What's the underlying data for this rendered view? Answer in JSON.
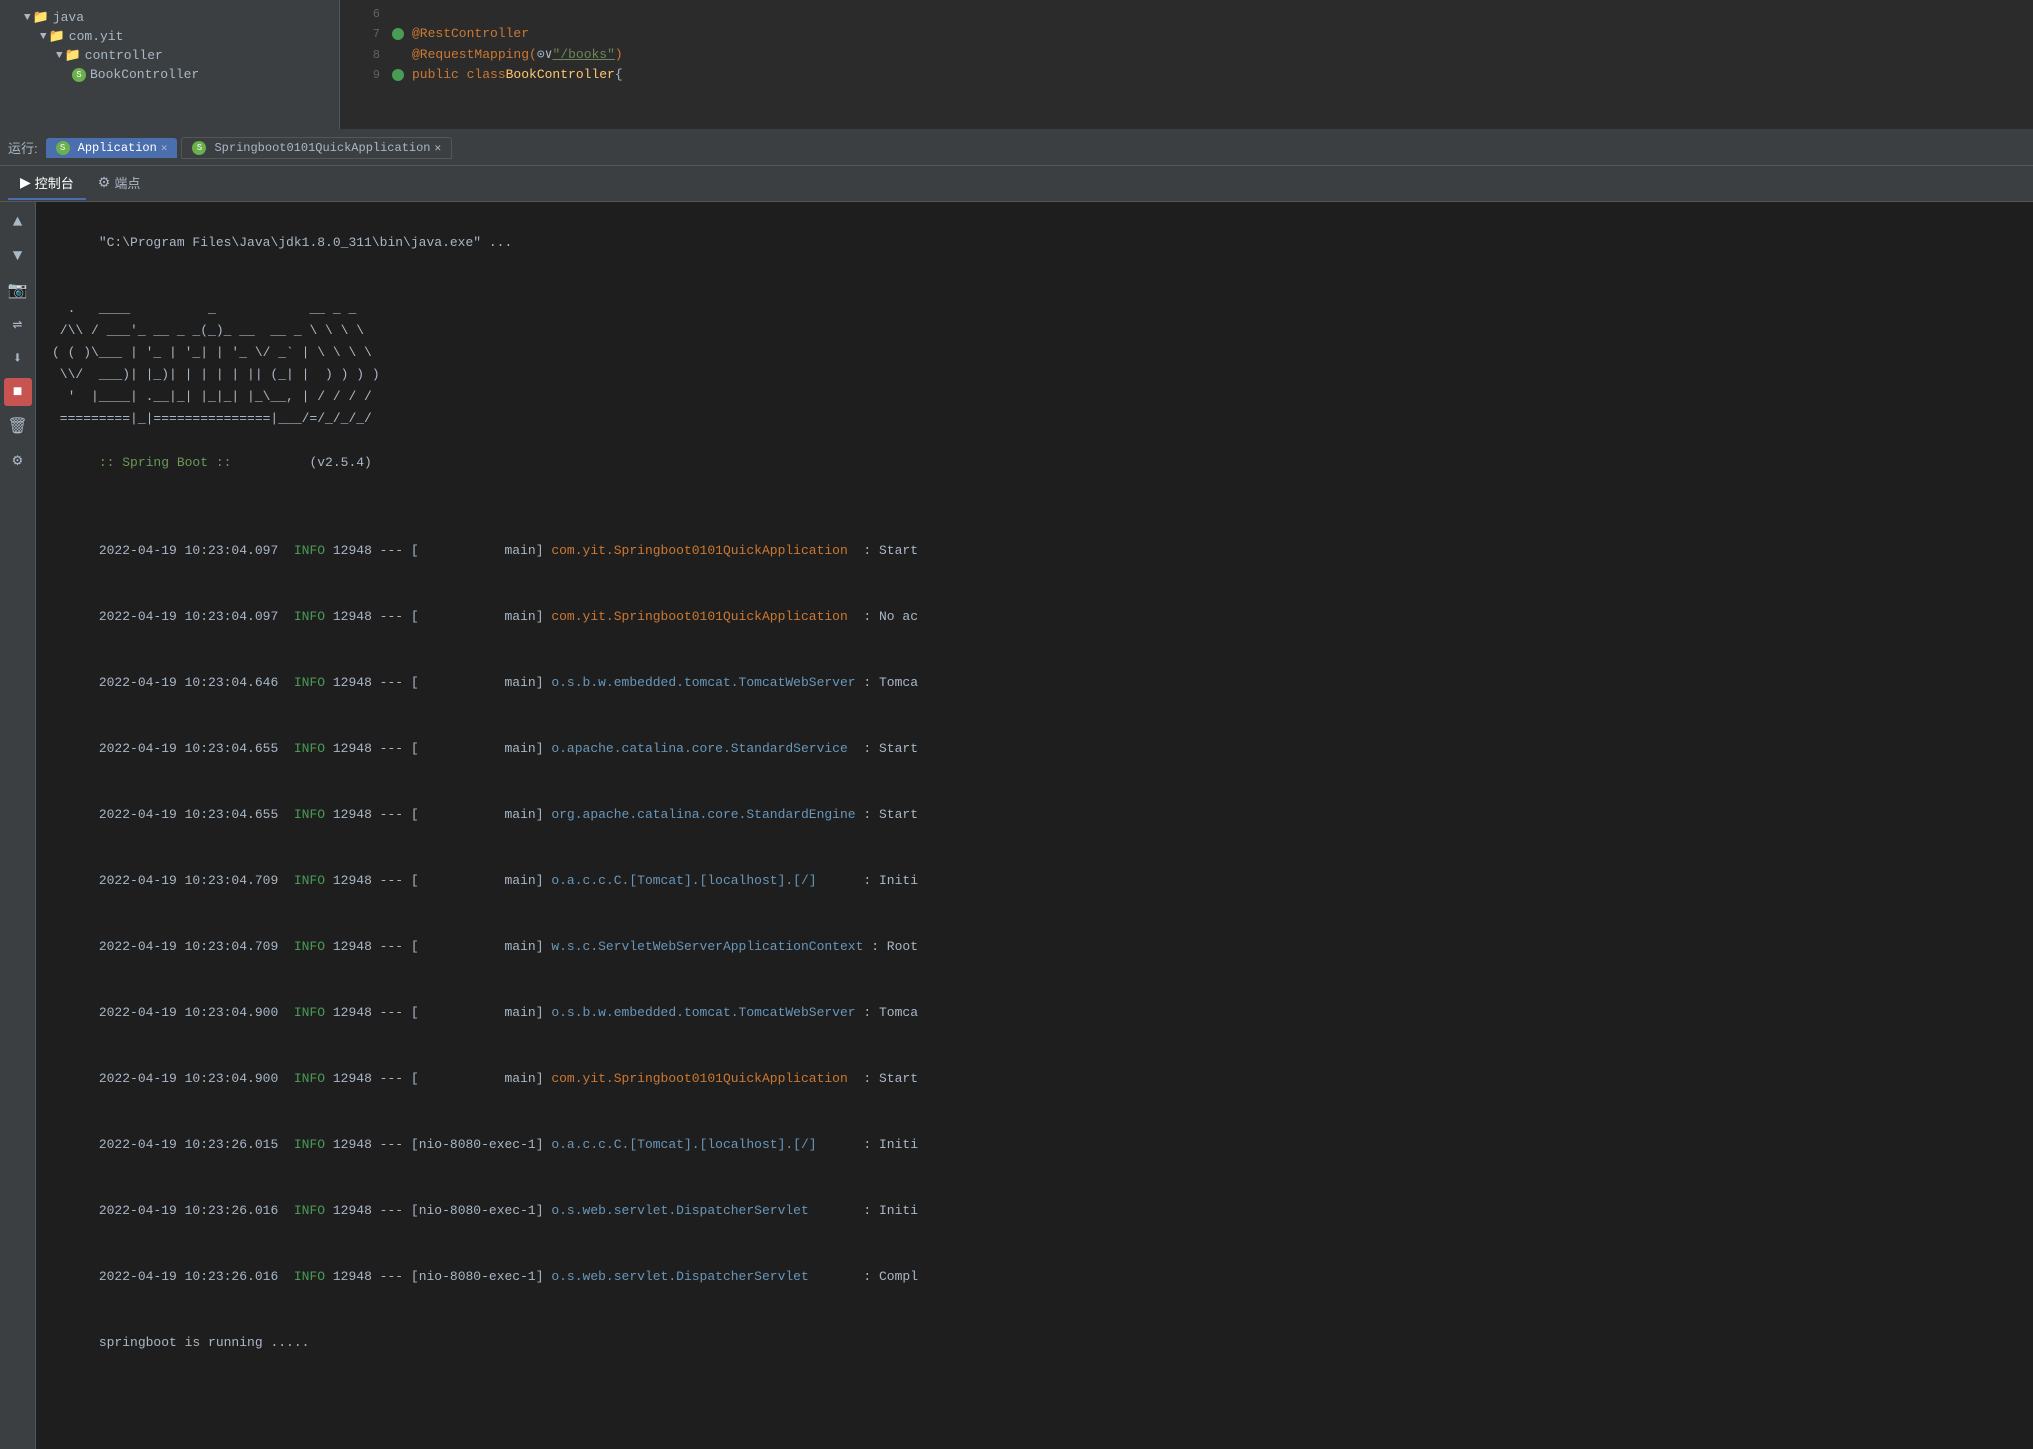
{
  "filetree": {
    "items": [
      {
        "label": "java",
        "indent": 1,
        "type": "folder",
        "expanded": true
      },
      {
        "label": "com.yit",
        "indent": 2,
        "type": "folder",
        "expanded": true
      },
      {
        "label": "controller",
        "indent": 3,
        "type": "folder",
        "expanded": true
      },
      {
        "label": "BookController",
        "indent": 4,
        "type": "spring-file"
      }
    ]
  },
  "code": {
    "lines": [
      {
        "num": "6",
        "gutter": "",
        "content": ""
      },
      {
        "num": "7",
        "gutter": "▶",
        "annotation": "@RestController",
        "rest": ""
      },
      {
        "num": "8",
        "gutter": "",
        "annotation": "@RequestMapping(",
        "param": "⊙∨\"/books\"",
        "closing": ")"
      },
      {
        "num": "9",
        "gutter": "▶",
        "keyword": "public class ",
        "classname": "BookController",
        "rest": " {"
      }
    ]
  },
  "run_toolbar": {
    "label": "运行:",
    "tabs": [
      {
        "label": "Application",
        "active": true,
        "icon": "spring"
      },
      {
        "label": "Springboot0101QuickApplication",
        "active": false,
        "icon": "spring"
      }
    ]
  },
  "bottom_tabs": {
    "tabs": [
      {
        "label": "控制台",
        "icon": "▶",
        "active": true
      },
      {
        "label": "端点",
        "icon": "⚙",
        "active": false
      }
    ]
  },
  "console": {
    "path_line": "\"C:\\Program Files\\Java\\jdk1.8.0_311\\bin\\java.exe\" ...",
    "ascii_art": [
      "  .   ____          _            __ _ _",
      " /\\\\ / ___'_ __ _ _(_)_ __  __ _ \\ \\ \\ \\",
      "( ( )\\___ | '_ | '_| | '_ \\/ _` | \\ \\ \\ \\",
      " \\\\/  ___)| |_)| | | | | || (_| |  ) ) ) )",
      "  '  |____| .__|_| |_|_| |_\\__, | / / / /",
      " =========|_|===============|___/=/_/_/_/"
    ],
    "spring_label": ":: Spring Boot ::",
    "spring_version": "          (v2.5.4)",
    "log_lines": [
      {
        "timestamp": "2022-04-19 10:23:04.097",
        "level": "INFO",
        "pid": "12948",
        "sep": "---",
        "thread": "           main",
        "class": "com.yit.Springboot0101QuickApplication",
        "class_type": "app",
        "message": ": Start"
      },
      {
        "timestamp": "2022-04-19 10:23:04.097",
        "level": "INFO",
        "pid": "12948",
        "sep": "---",
        "thread": "           main",
        "class": "com.yit.Springboot0101QuickApplication",
        "class_type": "app",
        "message": ": No ac"
      },
      {
        "timestamp": "2022-04-19 10:23:04.646",
        "level": "INFO",
        "pid": "12948",
        "sep": "---",
        "thread": "           main",
        "class": "o.s.b.w.embedded.tomcat.TomcatWebServer",
        "class_type": "tomcat",
        "message": ": Tomca"
      },
      {
        "timestamp": "2022-04-19 10:23:04.655",
        "level": "INFO",
        "pid": "12948",
        "sep": "---",
        "thread": "           main",
        "class": "o.apache.catalina.core.StandardService",
        "class_type": "catalina",
        "message": ": Start"
      },
      {
        "timestamp": "2022-04-19 10:23:04.655",
        "level": "INFO",
        "pid": "12948",
        "sep": "---",
        "thread": "           main",
        "class": "org.apache.catalina.core.StandardEngine",
        "class_type": "catalina",
        "message": ": Start"
      },
      {
        "timestamp": "2022-04-19 10:23:04.709",
        "level": "INFO",
        "pid": "12948",
        "sep": "---",
        "thread": "           main",
        "class": "o.a.c.c.C.[Tomcat].[localhost].[/]",
        "class_type": "tomcat",
        "message": ": Initi"
      },
      {
        "timestamp": "2022-04-19 10:23:04.709",
        "level": "INFO",
        "pid": "12948",
        "sep": "---",
        "thread": "           main",
        "class": "w.s.c.ServletWebServerApplicationContext",
        "class_type": "web",
        "message": ": Root "
      },
      {
        "timestamp": "2022-04-19 10:23:04.900",
        "level": "INFO",
        "pid": "12948",
        "sep": "---",
        "thread": "           main",
        "class": "o.s.b.w.embedded.tomcat.TomcatWebServer",
        "class_type": "tomcat",
        "message": ": Tomca"
      },
      {
        "timestamp": "2022-04-19 10:23:04.900",
        "level": "INFO",
        "pid": "12948",
        "sep": "---",
        "thread": "           main",
        "class": "com.yit.Springboot0101QuickApplication",
        "class_type": "app",
        "message": ": Start"
      },
      {
        "timestamp": "2022-04-19 10:23:26.015",
        "level": "INFO",
        "pid": "12948",
        "sep": "---",
        "thread": "[nio-8080-exec-1]",
        "class": "o.a.c.c.C.[Tomcat].[localhost].[/]",
        "class_type": "tomcat",
        "message": ": Initi"
      },
      {
        "timestamp": "2022-04-19 10:23:26.016",
        "level": "INFO",
        "pid": "12948",
        "sep": "---",
        "thread": "[nio-8080-exec-1]",
        "class": "o.s.web.servlet.DispatcherServlet",
        "class_type": "servlet",
        "message": ": Initi"
      },
      {
        "timestamp": "2022-04-19 10:23:26.016",
        "level": "INFO",
        "pid": "12948",
        "sep": "---",
        "thread": "[nio-8080-exec-1]",
        "class": "o.s.web.servlet.DispatcherServlet",
        "class_type": "servlet",
        "message": ": Compl"
      }
    ],
    "running_message": "springboot is running ....."
  }
}
